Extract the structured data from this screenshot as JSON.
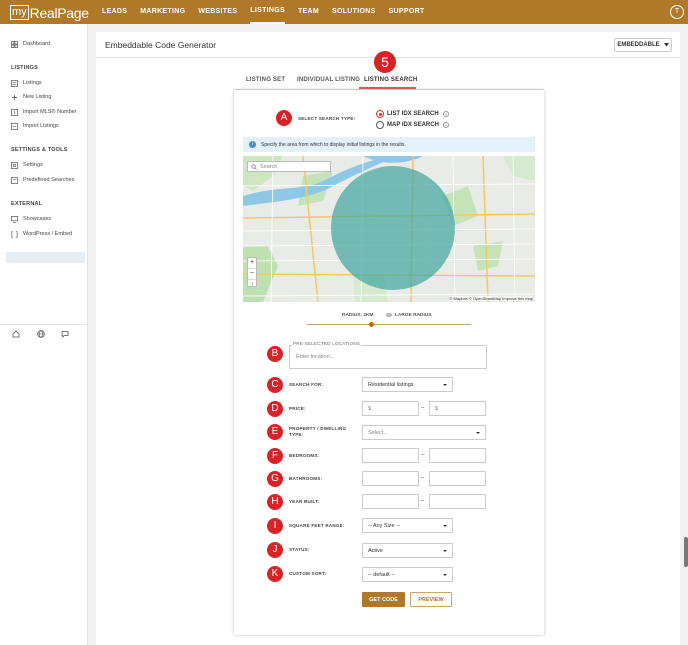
{
  "brand": {
    "logo_my": "my",
    "logo_rest": "RealPage",
    "accent": "#b0792a",
    "marker_color": "#d92128"
  },
  "topnav": {
    "items": [
      "LEADS",
      "MARKETING",
      "WEBSITES",
      "LISTINGS",
      "TEAM",
      "SOLUTIONS",
      "SUPPORT"
    ],
    "active": "LISTINGS",
    "avatar": "T"
  },
  "sidebar": {
    "dashboard": "Dashboard",
    "listings_section": "LISTINGS",
    "listings": "Listings",
    "new_listing": "New Listing",
    "import_mls": "Import MLS® Number",
    "import_listings": "Import Listings",
    "settings_section": "SETTINGS & TOOLS",
    "settings": "Settings",
    "predefined": "Predefined Searches",
    "external_section": "EXTERNAL",
    "showcases": "Showcases",
    "wordpress": "WordPress / Embed"
  },
  "header": {
    "title": "Embeddable Code Generator",
    "dropdown": "EMBEDDABLE"
  },
  "tabs": {
    "listing_set": "LISTING SET",
    "individual_listing": "INDIVIDUAL LISTING",
    "listing_search": "LISTING SEARCH"
  },
  "markers": {
    "tab": "5",
    "A": "A",
    "B": "B",
    "C": "C",
    "D": "D",
    "E": "E",
    "F": "F",
    "G": "G",
    "H": "H",
    "I": "I",
    "J": "J",
    "K": "K"
  },
  "search_type": {
    "label": "SELECT SEARCH TYPE:",
    "option1": "LIST IDX SEARCH",
    "option2": "MAP IDX SEARCH",
    "selected": "LIST IDX SEARCH"
  },
  "info": {
    "text": "Specify the area from which to display initial listings in the results."
  },
  "map": {
    "search_placeholder": "Search",
    "zoom_in": "+",
    "zoom_out": "−",
    "attribution": "© Mapbox © OpenStreetMap Improve this map"
  },
  "radius": {
    "label": "RADIUS: 2KM",
    "large_label": "LARGE RADIUS",
    "slider_value": 0.38
  },
  "form": {
    "preselected_label": "PRE-SELECTED LOCATIONS",
    "location_placeholder": "Enter location...",
    "search_for_label": "SEARCH FOR:",
    "search_for_value": "Residential listings",
    "price_label": "PRICE:",
    "price_min": "$",
    "price_max": "$",
    "property_label_1": "PROPERTY / DWELLING",
    "property_label_2": "TYPE:",
    "property_placeholder": "Select...",
    "bedrooms_label": "BEDROOMS:",
    "bathrooms_label": "BATHROOMS:",
    "year_built_label": "YEAR BUILT:",
    "sqft_label": "SQUARE FEET RANGE:",
    "sqft_value": "-- Any Size --",
    "status_label": "STATUS:",
    "status_value": "Active",
    "sort_label": "CUSTOM SORT:",
    "sort_value": "-- default --",
    "dash": "–"
  },
  "buttons": {
    "get_code": "GET CODE",
    "preview": "PREVIEW"
  }
}
